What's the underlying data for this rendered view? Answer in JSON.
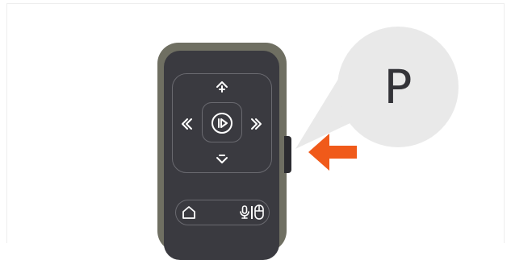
{
  "key_callout": {
    "letter": "P"
  },
  "colors": {
    "remote_body": "#3a3a40",
    "remote_rim": "#6f6f62",
    "button_outline": "#6a6a70",
    "icon": "#ffffff",
    "callout": "#e9e9e9",
    "arrow": "#f05a1a"
  },
  "icons": {
    "up": "volume-up-arrow-icon",
    "down": "volume-down-arrow-icon",
    "left": "previous-icon",
    "right": "next-icon",
    "center": "play-pause-icon",
    "home": "home-icon",
    "mic": "microphone-icon",
    "mouse": "mouse-icon"
  }
}
